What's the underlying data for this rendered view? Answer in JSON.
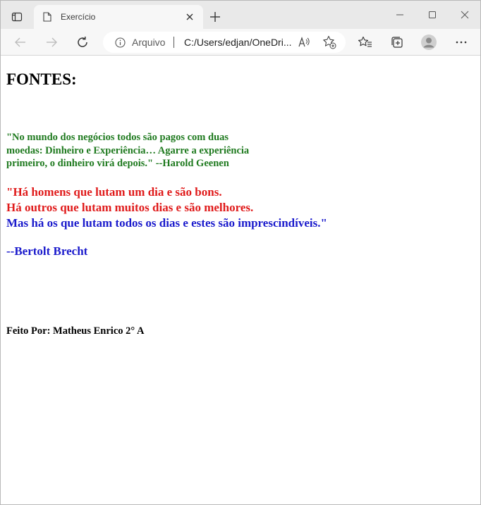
{
  "tab": {
    "title": "Exercício"
  },
  "address": {
    "origin_label": "Arquivo",
    "url": "C:/Users/edjan/OneDri..."
  },
  "icons": {
    "tab_actions": "tab-actions-icon",
    "favicon": "file-icon",
    "tab_close": "close-icon",
    "new_tab": "plus-icon",
    "minimize": "minimize-icon",
    "maximize": "maximize-icon",
    "close_window": "close-icon",
    "back": "arrow-left-icon",
    "forward": "arrow-right-icon",
    "refresh": "refresh-icon",
    "info": "info-icon",
    "read_aloud": "read-aloud-icon",
    "add_favorite": "star-plus-icon",
    "favorites": "favorites-icon",
    "collections": "collections-icon",
    "profile": "avatar-icon",
    "more": "more-icon"
  },
  "page": {
    "heading": "FONTES:",
    "quote1": [
      "\"No mundo dos negócios todos são pagos com duas",
      "moedas: Dinheiro e Experiência… Agarre a experiência",
      "primeiro, o dinheiro virá depois.\" --Harold Geenen"
    ],
    "quote2": {
      "red_lines": [
        "\"Há homens que lutam um dia e são bons.",
        "Há outros que lutam muitos dias e são melhores."
      ],
      "blue_line": "Mas há os que lutam todos os dias e estes são imprescindíveis.\""
    },
    "author": "--Bertolt Brecht",
    "credits": "Feito Por: Matheus Enrico 2° A"
  },
  "colors": {
    "green_quote": "#1f7a1f",
    "red_quote": "#e01b1b",
    "blue_quote": "#1a1acc",
    "tabstrip_bg": "#e9e9e9",
    "toolbar_bg": "#f7f7f7"
  }
}
